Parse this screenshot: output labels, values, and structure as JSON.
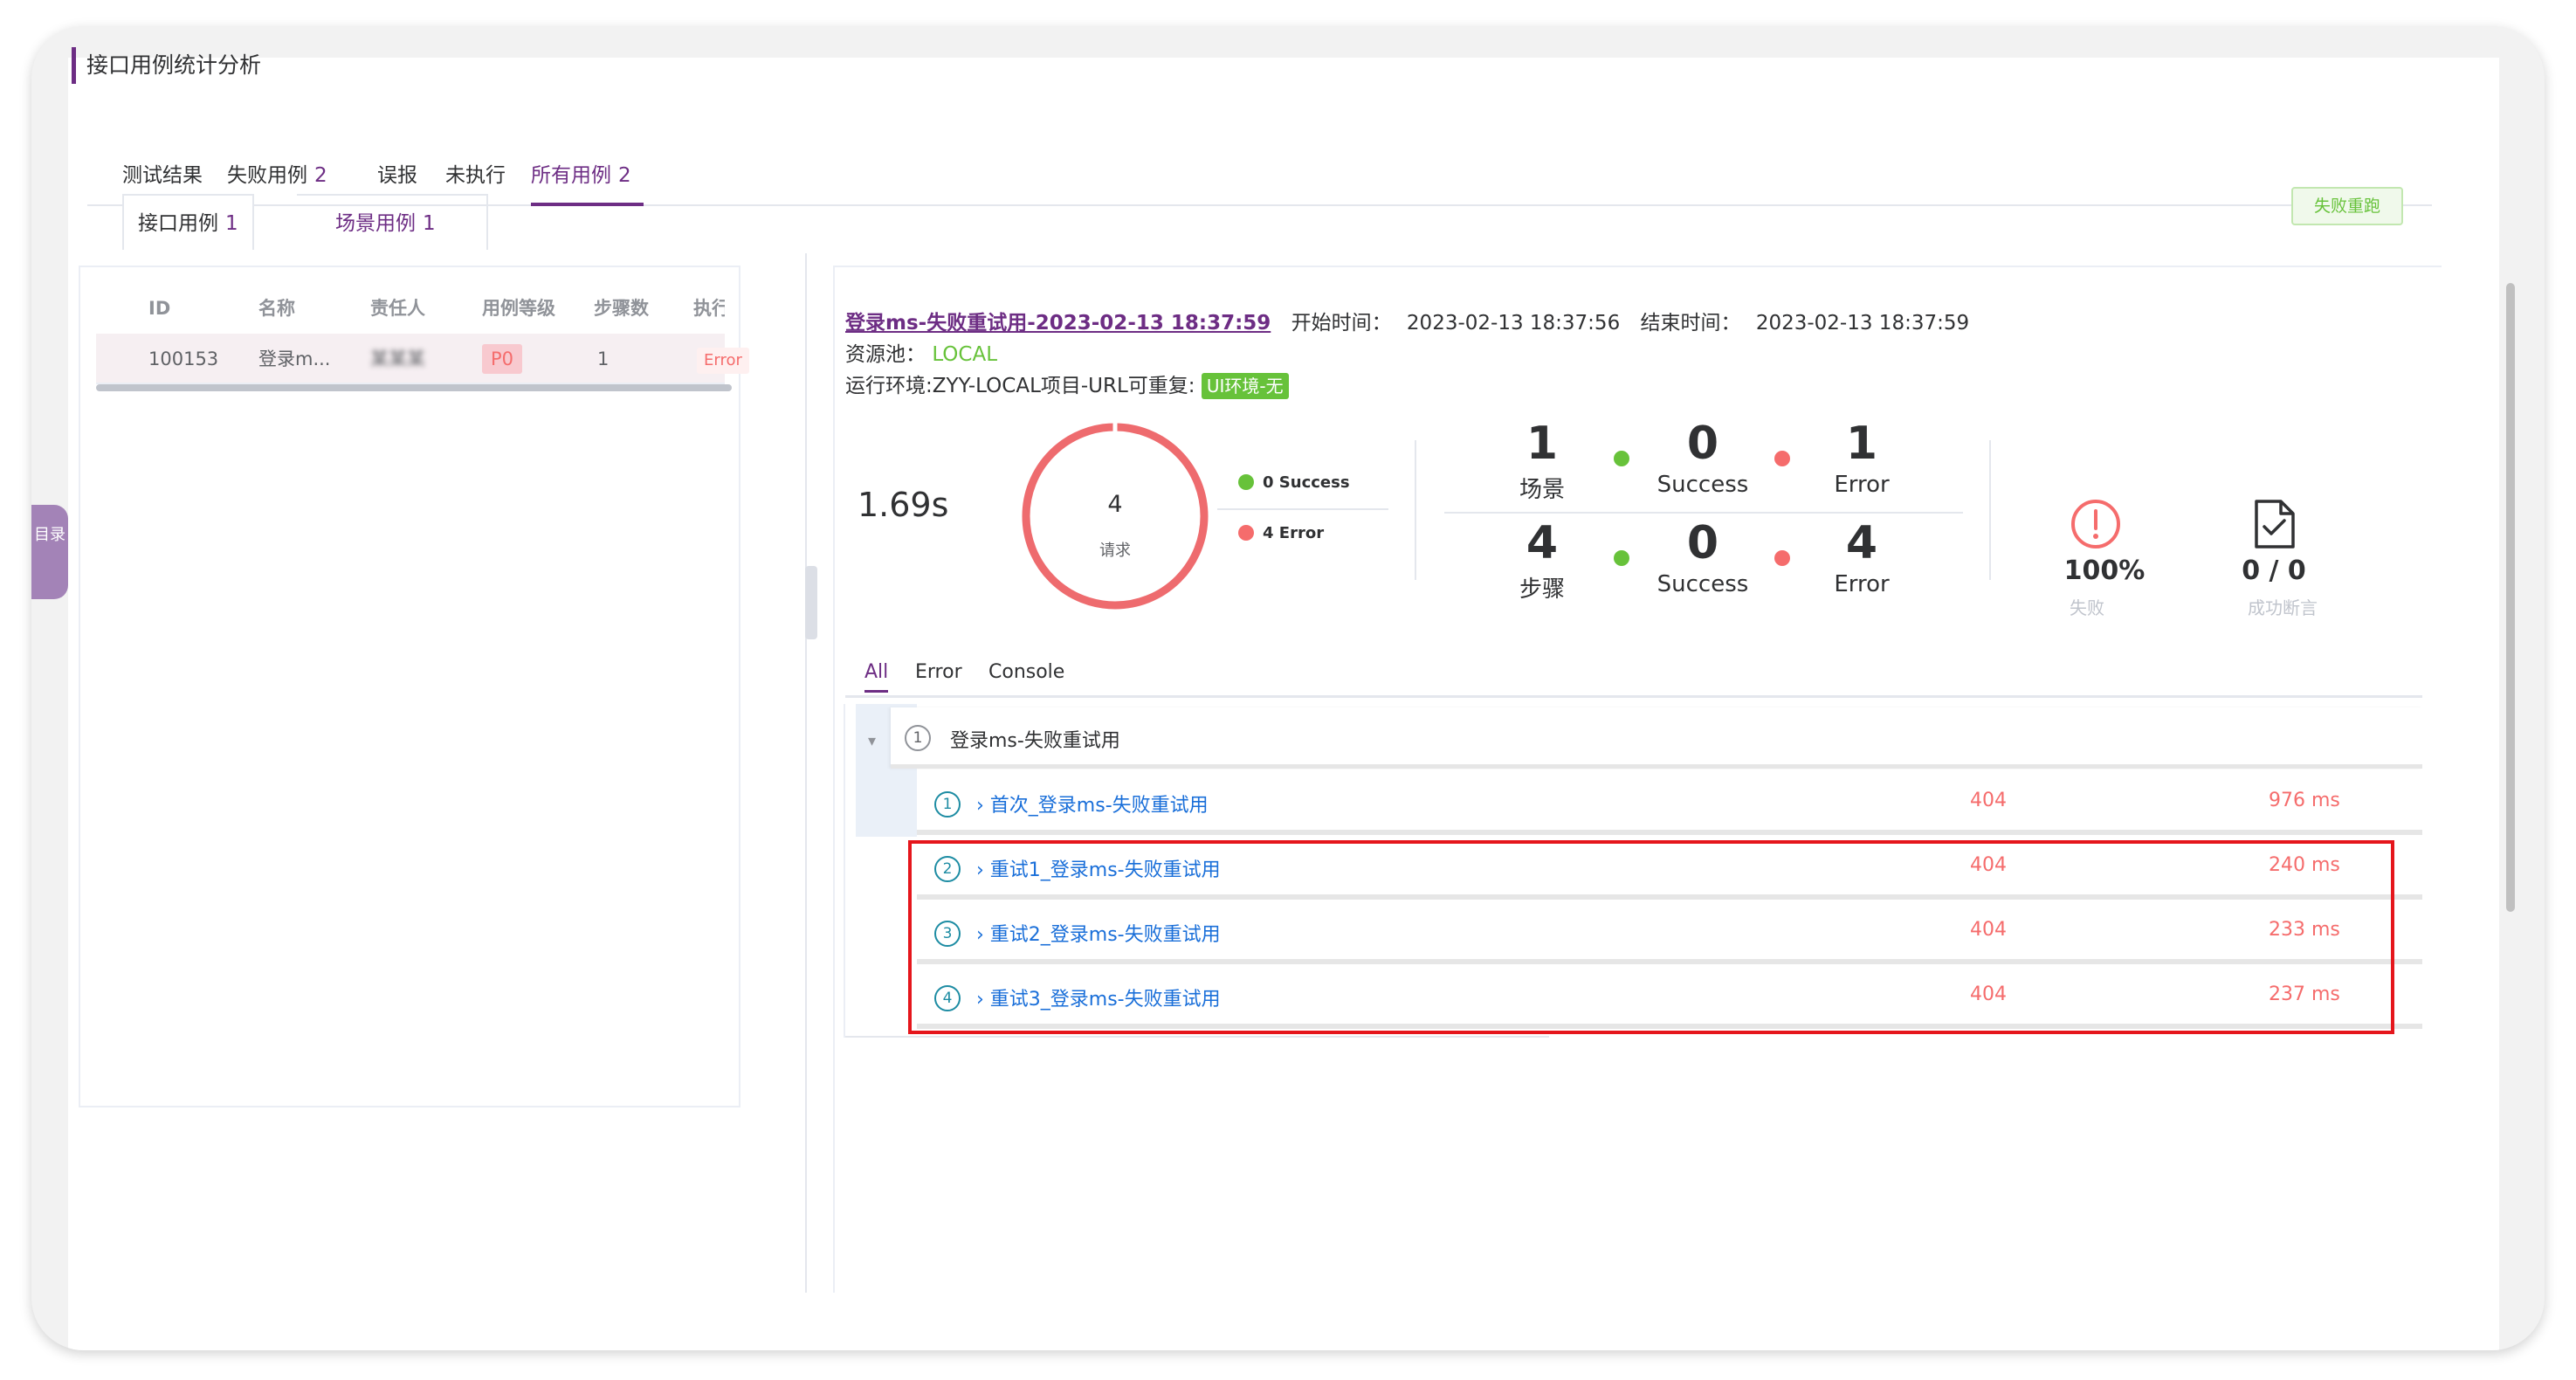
{
  "page": {
    "title": "接口用例统计分析"
  },
  "side_tab": {
    "label": "目录"
  },
  "main_tabs": [
    {
      "label": "测试结果",
      "count": ""
    },
    {
      "label": "失败用例",
      "count": "2"
    },
    {
      "label": "误报",
      "count": ""
    },
    {
      "label": "未执行",
      "count": ""
    },
    {
      "label": "所有用例",
      "count": "2"
    }
  ],
  "sub_tabs": [
    {
      "label": "接口用例",
      "count": "1"
    },
    {
      "label": "场景用例",
      "count": "1"
    }
  ],
  "rerun_button": "失败重跑",
  "table": {
    "headers": [
      "ID",
      "名称",
      "责任人",
      "用例等级",
      "步骤数",
      "执行结果"
    ],
    "rows": [
      {
        "id": "100153",
        "name": "登录m...",
        "owner": "某某某",
        "level": "P0",
        "steps": "1",
        "result": "Error"
      }
    ]
  },
  "report": {
    "scenario_link": "登录ms-失败重试用-2023-02-13 18:37:59",
    "start_label": "开始时间：",
    "start_time": "2023-02-13 18:37:56",
    "end_label": "结束时间：",
    "end_time": "2023-02-13 18:37:59",
    "pool_label": "资源池：",
    "pool_value": "LOCAL",
    "env_label": "运行环境:ZYY-LOCAL项目-URL可重复:",
    "env_tag": "UI环境-无",
    "duration": "1.69s",
    "ring_count": "4",
    "ring_label": "请求",
    "legend_success": "0 Success",
    "legend_error": "4 Error",
    "stats": {
      "scenario_total": "1",
      "scenario_label": "场景",
      "scenario_success": "0",
      "success_label": "Success",
      "scenario_error": "1",
      "error_label": "Error",
      "step_total": "4",
      "step_label": "步骤",
      "step_success": "0",
      "step_error": "4"
    },
    "fail_rate": "100%",
    "fail_label": "失败",
    "assert_value": "0 / 0",
    "assert_label": "成功断言",
    "colors": {
      "success": "#67c23a",
      "error": "#f56c6c",
      "accent": "#6d2d84"
    }
  },
  "result_tabs": [
    "All",
    "Error",
    "Console"
  ],
  "tree": {
    "scenario": {
      "index": "1",
      "name": "登录ms-失败重试用"
    },
    "requests": [
      {
        "index": "1",
        "name": "首次_登录ms-失败重试用",
        "code": "404",
        "time": "976 ms"
      },
      {
        "index": "2",
        "name": "重试1_登录ms-失败重试用",
        "code": "404",
        "time": "240 ms"
      },
      {
        "index": "3",
        "name": "重试2_登录ms-失败重试用",
        "code": "404",
        "time": "233 ms"
      },
      {
        "index": "4",
        "name": "重试3_登录ms-失败重试用",
        "code": "404",
        "time": "237 ms"
      }
    ]
  }
}
